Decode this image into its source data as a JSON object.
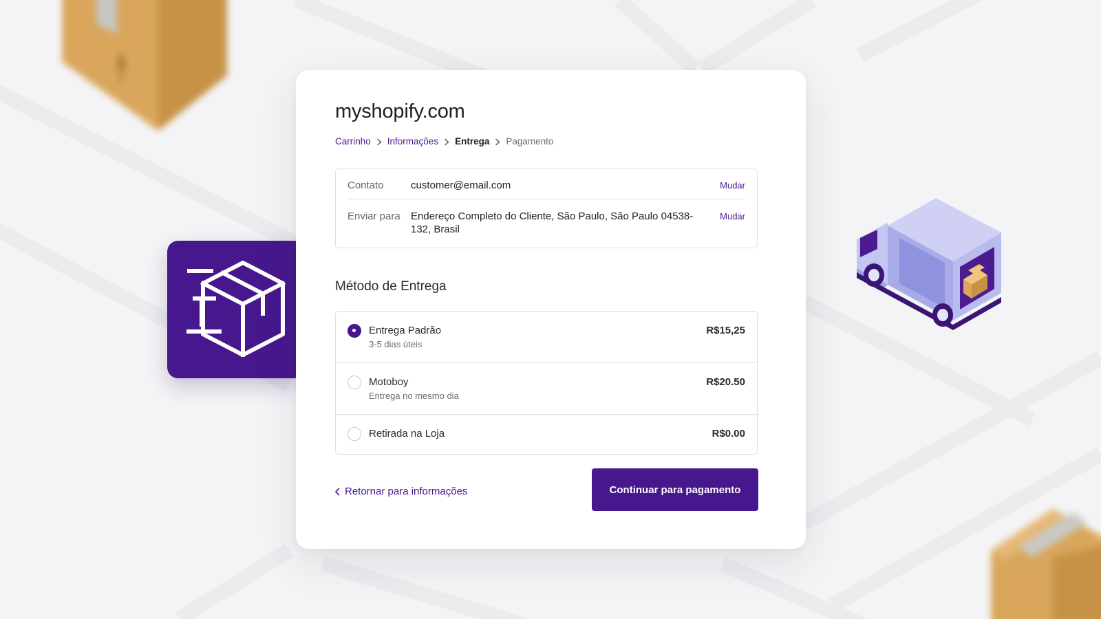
{
  "store": {
    "title": "myshopify.com"
  },
  "breadcrumb": {
    "items": [
      {
        "label": "Carrinho",
        "state": "done"
      },
      {
        "label": "Informações",
        "state": "done"
      },
      {
        "label": "Entrega",
        "state": "current"
      },
      {
        "label": "Pagamento",
        "state": "pending"
      }
    ]
  },
  "review": {
    "contact_label": "Contato",
    "contact_value": "customer@email.com",
    "contact_change": "Mudar",
    "ship_label": "Enviar para",
    "ship_value": "Endereço Completo do Cliente, São Paulo, São Paulo 04538-132, Brasil",
    "ship_change": "Mudar"
  },
  "shipping": {
    "title": "Método de Entrega",
    "options": [
      {
        "name": "Entrega Padrão",
        "detail": "3-5 dias úteis",
        "price": "R$15,25",
        "selected": true
      },
      {
        "name": "Motoboy",
        "detail": "Entrega no mesmo dia",
        "price": "R$20.50",
        "selected": false
      },
      {
        "name": "Retirada na Loja",
        "detail": "",
        "price": "R$0.00",
        "selected": false
      }
    ]
  },
  "actions": {
    "back_label": "Retornar para informações",
    "continue_label": "Continuar para pagamento"
  },
  "icons": {
    "app_tile": "shipping-box-icon",
    "truck": "delivery-truck-illustration"
  },
  "colors": {
    "accent": "#47178d",
    "background": "#f4f4f6",
    "card": "#ffffff"
  }
}
